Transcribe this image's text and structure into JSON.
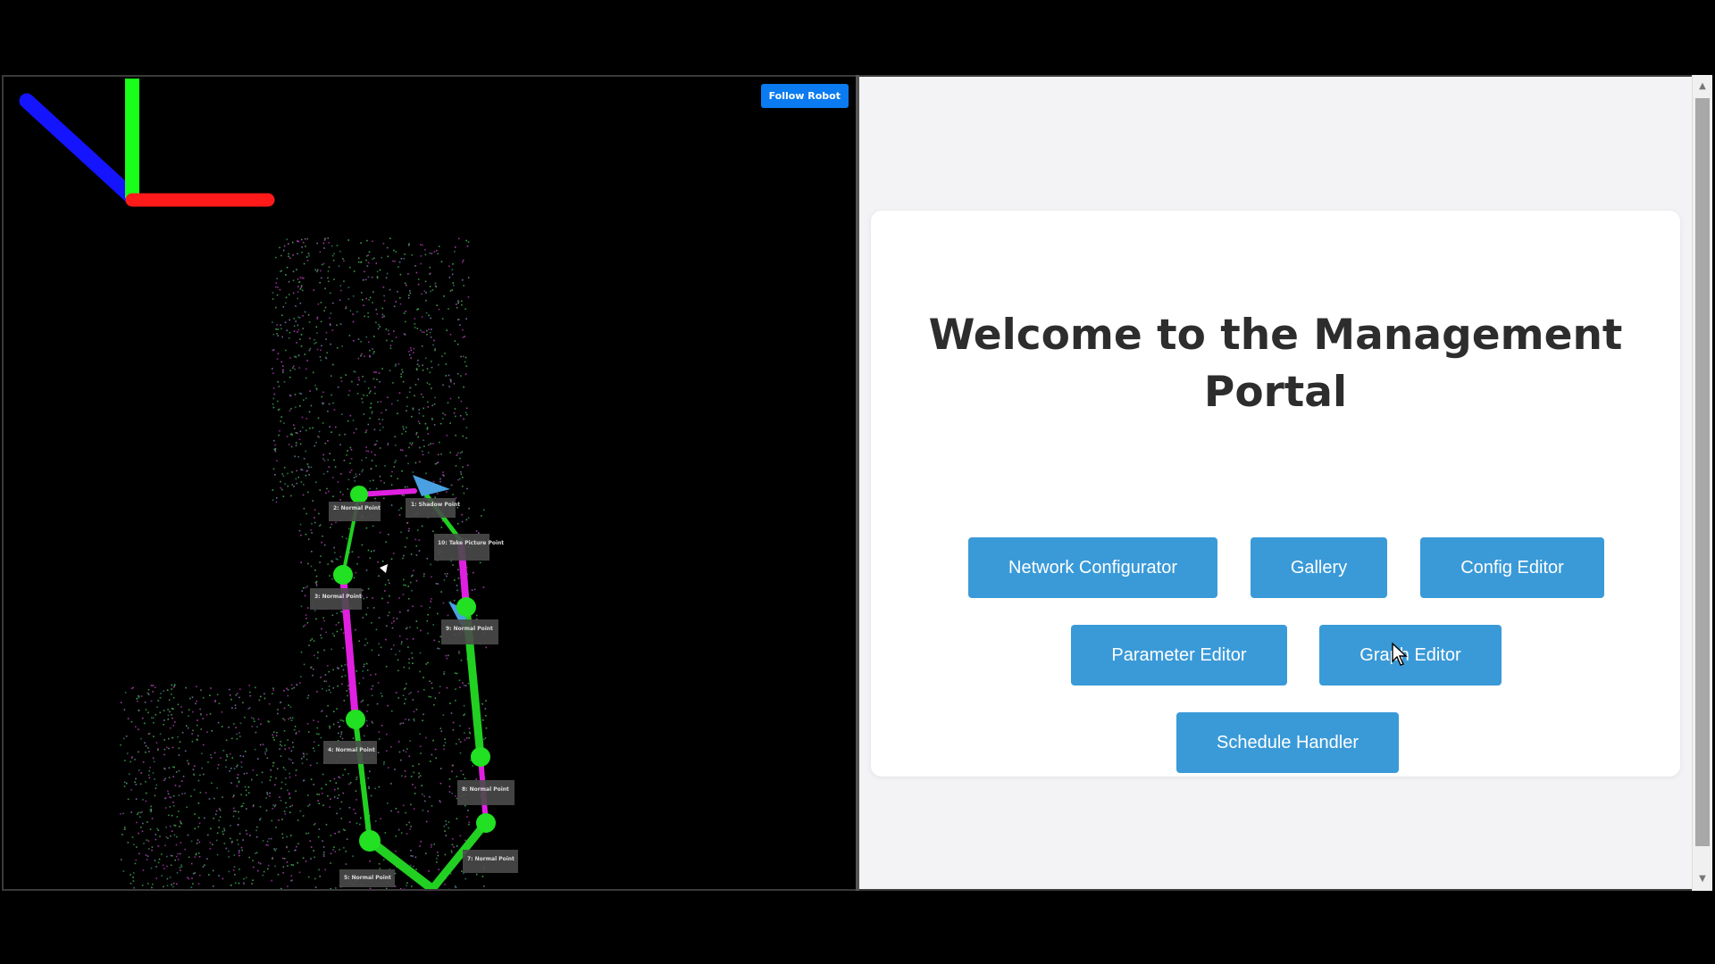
{
  "viewer": {
    "follow_button": "Follow Robot",
    "axes_colors": {
      "x": "#ff1a1a",
      "y": "#1aff1a",
      "z": "#1414ff"
    },
    "waypoints": [
      {
        "label": "1: Shadow Point"
      },
      {
        "label": "2: Normal Point"
      },
      {
        "label": "3: Normal Point"
      },
      {
        "label": "4: Normal Point"
      },
      {
        "label": "5: Normal Point"
      },
      {
        "label": "7: Normal Point"
      },
      {
        "label": "8: Normal Point"
      },
      {
        "label": "9: Normal Point"
      },
      {
        "label": "10: Take Picture Point"
      }
    ]
  },
  "portal": {
    "title": "Welcome to the Management Portal",
    "buttons": {
      "network": "Network Configurator",
      "gallery": "Gallery",
      "config": "Config Editor",
      "parameter": "Parameter Editor",
      "graph": "Graph Editor",
      "schedule": "Schedule Handler"
    },
    "accent_color": "#3a9ad8"
  }
}
